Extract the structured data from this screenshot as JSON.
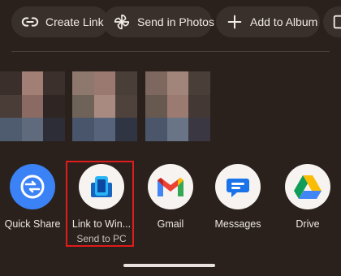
{
  "chips": [
    {
      "label": "Create Link",
      "icon": "link-icon"
    },
    {
      "label": "Send in Photos",
      "icon": "pinwheel-icon"
    },
    {
      "label": "Add to Album",
      "icon": "plus-icon"
    },
    {
      "label": "",
      "icon": "album-icon"
    }
  ],
  "thumbnails": [
    {
      "name": "photo-thumbnail-1"
    },
    {
      "name": "photo-thumbnail-2"
    },
    {
      "name": "photo-thumbnail-3"
    }
  ],
  "apps": [
    {
      "label": "Quick Share",
      "icon": "quick-share-icon"
    },
    {
      "label": "Link to Win...",
      "sub": "Send to PC",
      "icon": "link-to-windows-icon"
    },
    {
      "label": "Gmail",
      "icon": "gmail-icon"
    },
    {
      "label": "Messages",
      "icon": "messages-icon"
    },
    {
      "label": "Drive",
      "icon": "drive-icon"
    }
  ],
  "colors": {
    "background": "#2a211d",
    "chip_background": "#3a302b",
    "highlight": "#e01b1b",
    "quick_share_blue": "#3b82f6"
  }
}
